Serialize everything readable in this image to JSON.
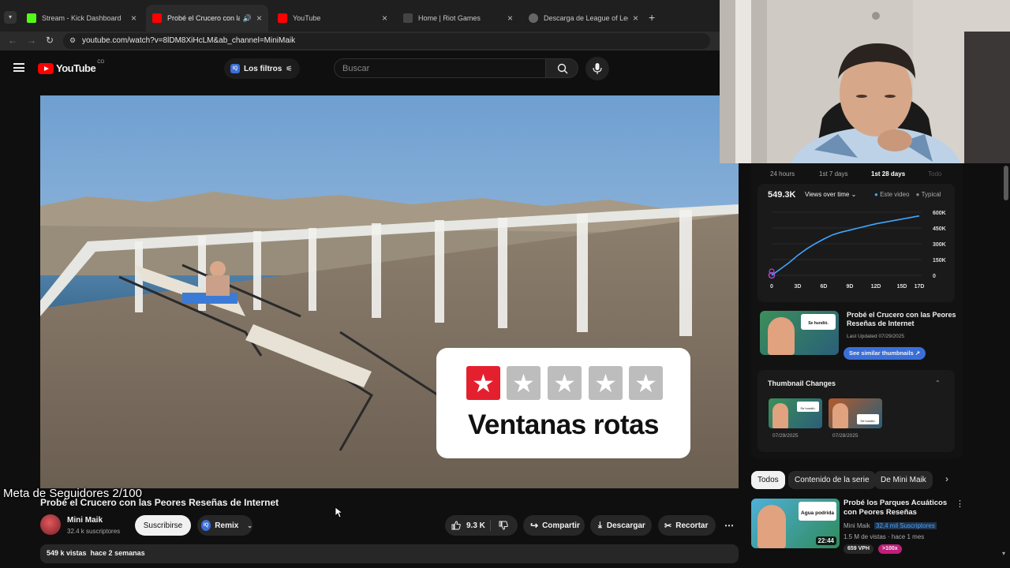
{
  "browser": {
    "tabs": [
      {
        "title": "Stream - Kick Dashboard",
        "fav_color": "#53fc18"
      },
      {
        "title": "Probé el Crucero con las Pe",
        "fav_color": "#ff0000"
      },
      {
        "title": "YouTube",
        "fav_color": "#ff0000"
      },
      {
        "title": "Home | Riot Games",
        "fav_color": "#444444"
      },
      {
        "title": "Descarga de League of Legend",
        "fav_color": "#666666"
      }
    ],
    "url": "youtube.com/watch?v=8lDM8XiHcLM&ab_channel=MiniMaik"
  },
  "header": {
    "logo_text": "YouTube",
    "country_code": "CO",
    "filters_label": "Los filtros",
    "search_placeholder": "Buscar"
  },
  "overlay": {
    "goal_text": "Meta de Seguidores 2/100"
  },
  "thumbnail_card": {
    "stars_filled": 1,
    "stars_total": 5,
    "text": "Ventanas rotas"
  },
  "video": {
    "title": "Probé el Crucero con las Peores Reseñas de Internet",
    "channel": "Mini Maik",
    "subscribers": "32.4 k suscriptores",
    "subscribe_label": "Suscribirse",
    "remix_label": "Remix",
    "likes": "9.3 K",
    "share_label": "Compartir",
    "download_label": "Descargar",
    "clip_label": "Recortar",
    "views_date": "549 k vistas  hace 2 semanas"
  },
  "analytics": {
    "tabs": [
      "24 hours",
      "1st 7 days",
      "1st 28 days",
      "Todo"
    ],
    "active_tab": 2,
    "total": "549.3K",
    "metric_select": "Views over time",
    "legend": [
      "Este video",
      "Typical"
    ],
    "legend_colors": [
      "#3ea6ff",
      "#888888"
    ],
    "chart_data": {
      "type": "line",
      "x": [
        0,
        1,
        2,
        3,
        4,
        5,
        6,
        7,
        8,
        9,
        10,
        11,
        12,
        13,
        14,
        15,
        16,
        17
      ],
      "series": [
        {
          "name": "Este video",
          "values": [
            0,
            60000,
            120000,
            190000,
            250000,
            300000,
            345000,
            385000,
            410000,
            430000,
            450000,
            470000,
            490000,
            505000,
            520000,
            535000,
            550000,
            565000
          ]
        }
      ],
      "xticks": [
        "0",
        "3D",
        "6D",
        "9D",
        "12D",
        "15D",
        "17D"
      ],
      "yticks": [
        "600K",
        "450K",
        "300K",
        "150K",
        "0"
      ],
      "ylim": [
        0,
        600000
      ],
      "xlim": [
        0,
        17
      ]
    },
    "thumb_title": "Probé el Crucero con las Peores Reseñas de Internet",
    "thumb_badge": "Se hundió.",
    "last_updated": "Last Updated 07/29/2025",
    "similar_label": "See similar thumbnails ↗",
    "changes_title": "Thumbnail Changes",
    "changes": [
      {
        "date": "07/29/2025",
        "badge": "Se hundió."
      },
      {
        "date": "07/28/2025",
        "badge": "Se hundió."
      }
    ]
  },
  "filter_chips": [
    "Todos",
    "Contenido de la serie",
    "De Mini Maik"
  ],
  "related": {
    "title": "Probé los Parques Acuáticos con Peores Reseñas",
    "badge": "Agua podrida",
    "duration": "22:44",
    "channel": "Mini Maik",
    "channel_subs": "32,4 mil Suscriptores",
    "meta": "1.5 M de vistas · hace 1 mes",
    "vph": "659 VPH",
    "multiplier": ">100x"
  }
}
